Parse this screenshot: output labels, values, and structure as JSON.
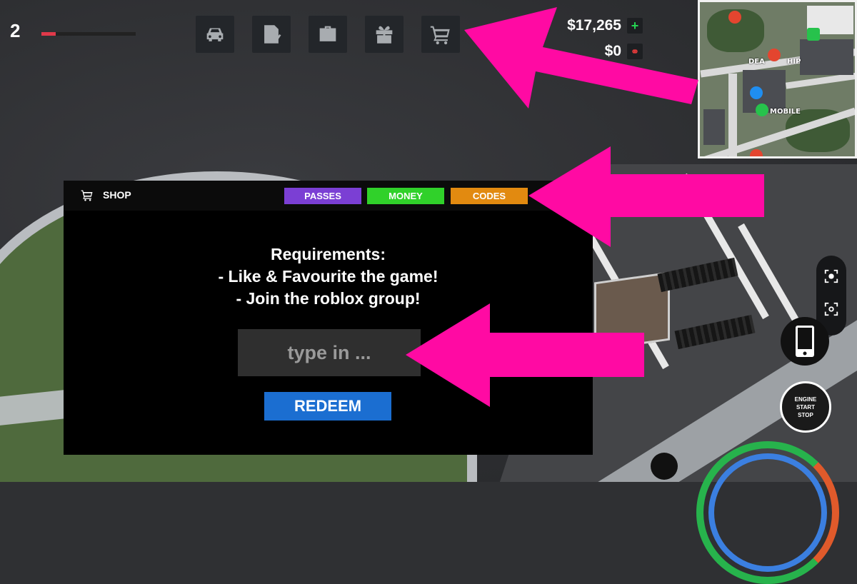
{
  "hud": {
    "level": "2",
    "level_progress": 0.15,
    "toolbar": [
      {
        "icon": "car-icon"
      },
      {
        "icon": "notepad-icon"
      },
      {
        "icon": "briefcase-icon"
      },
      {
        "icon": "gift-icon"
      },
      {
        "icon": "cart-icon"
      }
    ],
    "cash": "$17,265",
    "cash_add": "+",
    "bank": "$0"
  },
  "minimap": {
    "labels": [
      "DEA",
      "HIP",
      "MOBILE"
    ]
  },
  "shop": {
    "title": "SHOP",
    "tabs": {
      "passes": "PASSES",
      "money": "MONEY",
      "codes": "CODES"
    },
    "requirements": [
      "Requirements:",
      "- Like & Favourite the game!",
      "- Join the roblox group!"
    ],
    "code_placeholder": "type in ...",
    "redeem_label": "REDEEM"
  },
  "controls": {
    "engine": [
      "ENGINE",
      "START",
      "STOP"
    ]
  },
  "colors": {
    "arrow": "#ff0aa3",
    "passes": "#7b3fd4",
    "money": "#30d12a",
    "codes": "#e28a10",
    "redeem": "#1b6ed1"
  }
}
